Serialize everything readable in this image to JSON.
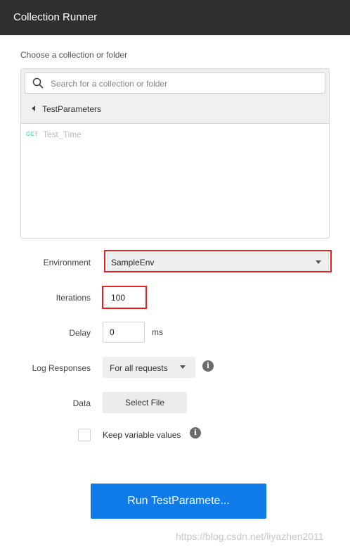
{
  "window": {
    "title": "Collection Runner"
  },
  "collection_picker": {
    "label": "Choose a collection or folder",
    "search_placeholder": "Search for a collection or folder",
    "current_collection": "TestParameters",
    "requests": [
      {
        "method": "GET",
        "name": "Test_Time"
      }
    ]
  },
  "settings": {
    "environment": {
      "label": "Environment",
      "value": "SampleEnv"
    },
    "iterations": {
      "label": "Iterations",
      "value": "100"
    },
    "delay": {
      "label": "Delay",
      "value": "0",
      "unit": "ms"
    },
    "log_responses": {
      "label": "Log Responses",
      "value": "For all requests"
    },
    "data": {
      "label": "Data",
      "button_label": "Select File"
    },
    "keep_variables": {
      "label": "Keep variable values",
      "checked": false
    }
  },
  "run_button": {
    "label": "Run TestParamete..."
  },
  "watermark": "https://blog.csdn.net/liyazhen2011",
  "colors": {
    "titlebar": "#2f2f2f",
    "accent": "#0e7be8",
    "highlight": "#e82020",
    "get_method": "#7fd8c2"
  }
}
